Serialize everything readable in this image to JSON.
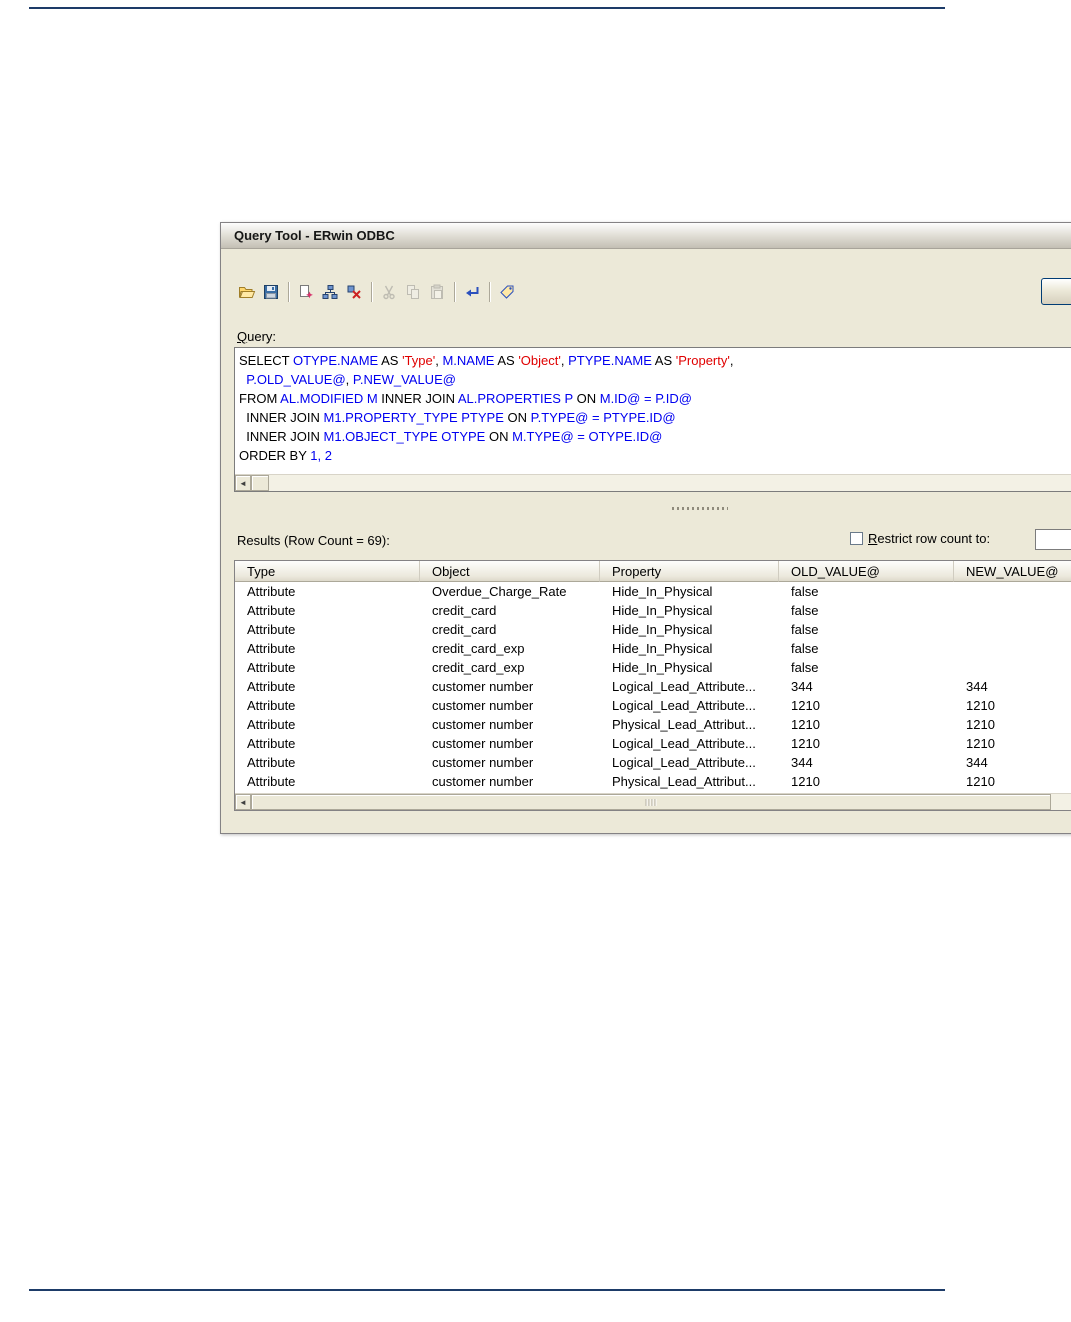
{
  "window": {
    "title": "Query Tool - ERwin ODBC"
  },
  "icons": {
    "scroll_left": "◄"
  },
  "toolbar": {
    "buttons": [
      {
        "icon": "open-icon"
      },
      {
        "icon": "save-icon"
      },
      {
        "separator": true
      },
      {
        "icon": "new-query-icon"
      },
      {
        "icon": "query-tree-icon"
      },
      {
        "icon": "delete-query-icon"
      },
      {
        "separator": true
      },
      {
        "icon": "cut-icon",
        "disabled": true
      },
      {
        "icon": "copy-icon",
        "disabled": true
      },
      {
        "icon": "paste-icon",
        "disabled": true
      },
      {
        "separator": true
      },
      {
        "icon": "execute-query-icon"
      },
      {
        "separator": true
      },
      {
        "icon": "tag-icon"
      }
    ]
  },
  "query": {
    "label": "Query:",
    "lines": [
      [
        {
          "t": "SELECT ",
          "c": "k"
        },
        {
          "t": "OTYPE.NAME",
          "c": "b"
        },
        {
          "t": " AS ",
          "c": "k"
        },
        {
          "t": "'Type'",
          "c": "r"
        },
        {
          "t": ", ",
          "c": "k"
        },
        {
          "t": "M.NAME",
          "c": "b"
        },
        {
          "t": " AS ",
          "c": "k"
        },
        {
          "t": "'Object'",
          "c": "r"
        },
        {
          "t": ", ",
          "c": "k"
        },
        {
          "t": "PTYPE.NAME",
          "c": "b"
        },
        {
          "t": " AS ",
          "c": "k"
        },
        {
          "t": "'Property'",
          "c": "r"
        },
        {
          "t": ",",
          "c": "k"
        }
      ],
      [
        {
          "t": "  ",
          "c": "k"
        },
        {
          "t": "P.OLD_VALUE@",
          "c": "b"
        },
        {
          "t": ", ",
          "c": "k"
        },
        {
          "t": "P.NEW_VALUE@",
          "c": "b"
        }
      ],
      [
        {
          "t": "FROM ",
          "c": "k"
        },
        {
          "t": "AL.MODIFIED M",
          "c": "b"
        },
        {
          "t": " INNER JOIN ",
          "c": "k"
        },
        {
          "t": "AL.PROPERTIES P",
          "c": "b"
        },
        {
          "t": " ON ",
          "c": "k"
        },
        {
          "t": "M.ID@ = P.ID@",
          "c": "b"
        }
      ],
      [
        {
          "t": "  INNER JOIN ",
          "c": "k"
        },
        {
          "t": "M1.PROPERTY_TYPE PTYPE",
          "c": "b"
        },
        {
          "t": " ON ",
          "c": "k"
        },
        {
          "t": "P.TYPE@ = PTYPE.ID@",
          "c": "b"
        }
      ],
      [
        {
          "t": "  INNER JOIN ",
          "c": "k"
        },
        {
          "t": "M1.OBJECT_TYPE OTYPE",
          "c": "b"
        },
        {
          "t": " ON ",
          "c": "k"
        },
        {
          "t": "M.TYPE@ = OTYPE.ID@",
          "c": "b"
        }
      ],
      [
        {
          "t": "ORDER BY ",
          "c": "k"
        },
        {
          "t": "1, 2",
          "c": "b"
        }
      ]
    ]
  },
  "results": {
    "label": "Results (Row Count = 69):",
    "restrict_label": "Restrict row count to:",
    "columns": [
      "Type",
      "Object",
      "Property",
      "OLD_VALUE@",
      "NEW_VALUE@"
    ],
    "rows": [
      [
        "Attribute",
        "Overdue_Charge_Rate",
        "Hide_In_Physical",
        "false",
        ""
      ],
      [
        "Attribute",
        "credit_card",
        "Hide_In_Physical",
        "false",
        ""
      ],
      [
        "Attribute",
        "credit_card",
        "Hide_In_Physical",
        "false",
        ""
      ],
      [
        "Attribute",
        "credit_card_exp",
        "Hide_In_Physical",
        "false",
        ""
      ],
      [
        "Attribute",
        "credit_card_exp",
        "Hide_In_Physical",
        "false",
        ""
      ],
      [
        "Attribute",
        "customer number",
        "Logical_Lead_Attribute...",
        "344",
        "344"
      ],
      [
        "Attribute",
        "customer number",
        "Logical_Lead_Attribute...",
        "1210",
        "1210"
      ],
      [
        "Attribute",
        "customer number",
        "Physical_Lead_Attribut...",
        "1210",
        "1210"
      ],
      [
        "Attribute",
        "customer number",
        "Logical_Lead_Attribute...",
        "1210",
        "1210"
      ],
      [
        "Attribute",
        "customer number",
        "Logical_Lead_Attribute...",
        "344",
        "344"
      ],
      [
        "Attribute",
        "customer number",
        "Physical_Lead_Attribut...",
        "1210",
        "1210"
      ]
    ]
  },
  "colors": {
    "window_bg": "#ece9d8",
    "sql_keyword": "#000000",
    "sql_identifier": "#0000f0",
    "sql_string": "#e00000",
    "page_rule": "#1d3b68"
  }
}
